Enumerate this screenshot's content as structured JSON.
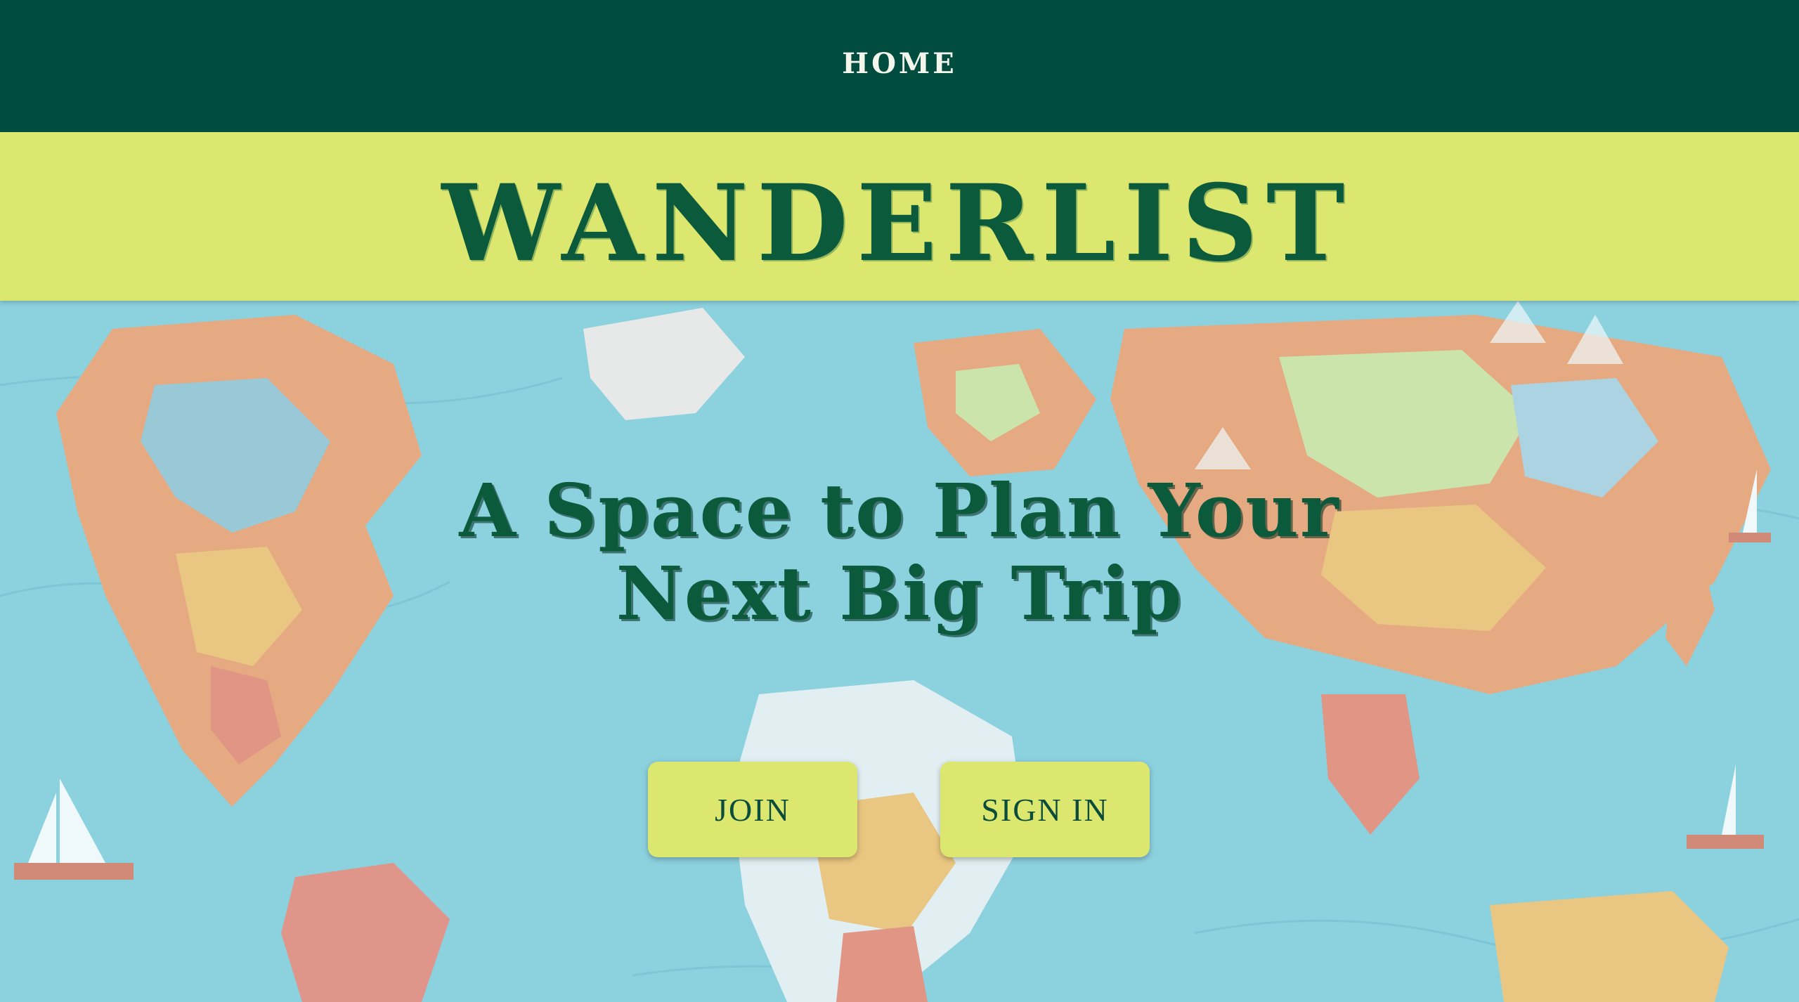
{
  "nav": {
    "home_label": "HOME"
  },
  "banner": {
    "brand": "WANDERLIST"
  },
  "hero": {
    "tagline_line1": "A Space to Plan Your",
    "tagline_line2": "Next Big Trip",
    "join_label": "JOIN",
    "signin_label": "SIGN IN",
    "background": "illustrated-world-map-image"
  },
  "colors": {
    "nav_bg": "#004d40",
    "accent": "#dbe76f",
    "brand_text": "#0b5a3c",
    "ocean": "#8fd0dc"
  }
}
